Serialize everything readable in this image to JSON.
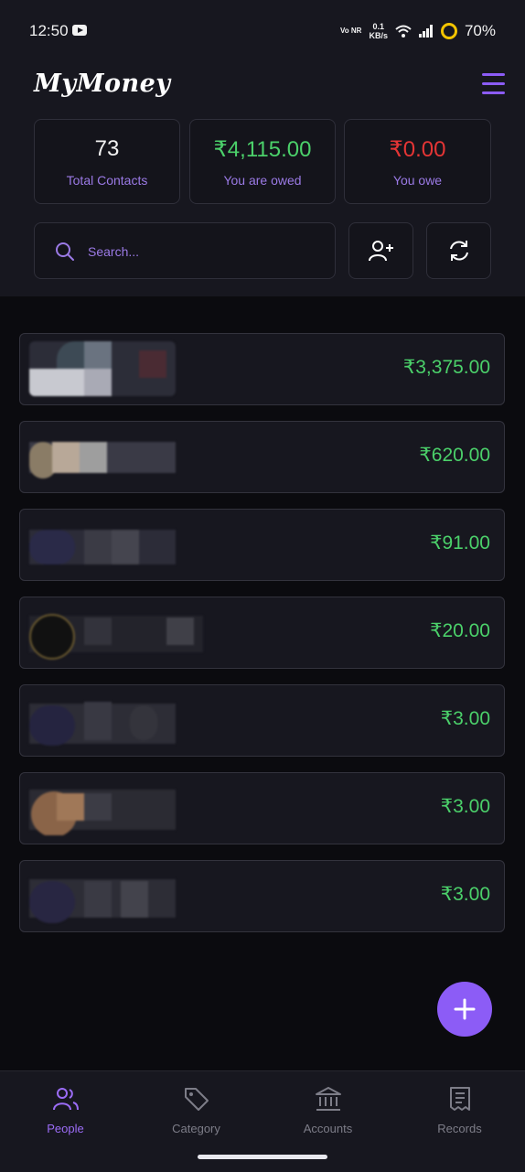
{
  "status_bar": {
    "time": "12:50",
    "network": "Vo NR",
    "speed_value": "0.1",
    "speed_unit": "KB/s",
    "battery": "70%"
  },
  "app": {
    "title": "MyMoney"
  },
  "stats": [
    {
      "value": "73",
      "label": "Total Contacts",
      "color": "#f2f2f2"
    },
    {
      "value": "₹4,115.00",
      "label": "You are owed",
      "color": "#4bd06a"
    },
    {
      "value": "₹0.00",
      "label": "You owe",
      "color": "#e53535"
    }
  ],
  "search": {
    "placeholder": "Search..."
  },
  "contacts": [
    {
      "amount": "₹3,375.00"
    },
    {
      "amount": "₹620.00"
    },
    {
      "amount": "₹91.00"
    },
    {
      "amount": "₹20.00"
    },
    {
      "amount": "₹3.00"
    },
    {
      "amount": "₹3.00"
    },
    {
      "amount": "₹3.00"
    }
  ],
  "nav": [
    {
      "label": "People",
      "icon": "people-icon",
      "active": true
    },
    {
      "label": "Category",
      "icon": "tag-icon",
      "active": false
    },
    {
      "label": "Accounts",
      "icon": "bank-icon",
      "active": false
    },
    {
      "label": "Records",
      "icon": "receipt-icon",
      "active": false
    }
  ],
  "colors": {
    "accent": "#8c5cf6",
    "positive": "#4bd06a",
    "negative": "#e53535",
    "background": "#0b0b0f",
    "surface": "#17171f"
  }
}
